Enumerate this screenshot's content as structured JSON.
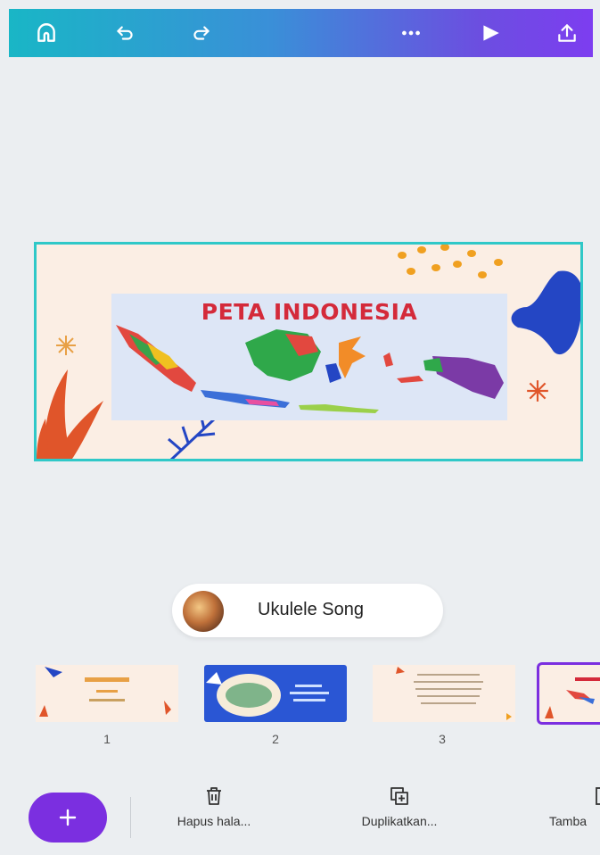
{
  "toolbar": {
    "icons": [
      "home-icon",
      "undo-icon",
      "redo-icon",
      "more-icon",
      "play-icon",
      "share-upload-icon"
    ],
    "background": [
      "#19b6c6",
      "#7d3df0"
    ]
  },
  "canvas": {
    "title": "PETA INDONESIA",
    "border_color": "#2fc8c8",
    "background": "#fbeee4"
  },
  "audio": {
    "track_name": "Ukulele Song"
  },
  "pages": [
    {
      "number": "1"
    },
    {
      "number": "2"
    },
    {
      "number": "3"
    },
    {
      "number": "",
      "selected": true
    }
  ],
  "bottom_bar": {
    "add_icon": "plus-icon",
    "tools": [
      {
        "label": "Hapus hala...",
        "icon": "trash-icon"
      },
      {
        "label": "Duplikatkan...",
        "icon": "duplicate-icon"
      },
      {
        "label": "Tamba",
        "icon": "add-page-icon"
      }
    ],
    "accent": "#7b2fe0"
  }
}
